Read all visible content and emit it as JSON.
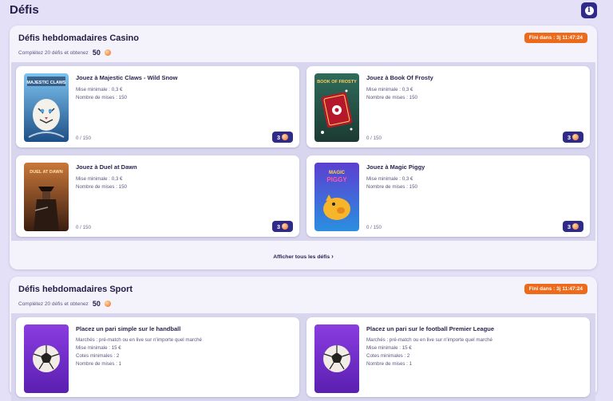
{
  "page": {
    "title": "Défis"
  },
  "casino": {
    "title": "Défis hebdomadaires Casino",
    "subtitle": "Complétez 20 défis et obtenez",
    "reward": "50",
    "timer": "Fini dans : 3j 11:47:24",
    "show_all": "Afficher tous les défis",
    "cards": [
      {
        "title": "Jouez à Majestic Claws - Wild Snow",
        "line1": "Mise minimale : 0,3 €",
        "line2": "Nombre de mises : 150",
        "progress": "0 / 150",
        "reward": "3",
        "thumb": "MAJESTIC CLAWS"
      },
      {
        "title": "Jouez à Book Of Frosty",
        "line1": "Mise minimale : 0,3 €",
        "line2": "Nombre de mises : 150",
        "progress": "0 / 150",
        "reward": "3",
        "thumb": "BOOK OF FROSTY"
      },
      {
        "title": "Jouez à Duel at Dawn",
        "line1": "Mise minimale : 0,3 €",
        "line2": "Nombre de mises : 150",
        "progress": "0 / 150",
        "reward": "3",
        "thumb": "DUEL AT DAWN"
      },
      {
        "title": "Jouez à Magic Piggy",
        "line1": "Mise minimale : 0,3 €",
        "line2": "Nombre de mises : 150",
        "progress": "0 / 150",
        "reward": "3",
        "thumb": "MAGIC PIGGY"
      }
    ]
  },
  "sport": {
    "title": "Défis hebdomadaires Sport",
    "subtitle": "Complétez 20 défis et obtenez",
    "reward": "50",
    "timer": "Fini dans : 3j 11:47:24",
    "cards": [
      {
        "title": "Placez un pari simple sur le handball",
        "line1": "Marchés : pré-match ou en live sur n'importe quel marché",
        "line2": "Mise minimale : 15 €",
        "line3": "Cotes minimales : 2",
        "line4": "Nombre de mises : 1"
      },
      {
        "title": "Placez un pari sur le football Premier League",
        "line1": "Marchés : pré-match ou en live sur n'importe quel marché",
        "line2": "Mise minimale : 15 €",
        "line3": "Cotes minimales : 2",
        "line4": "Nombre de mises : 1"
      }
    ]
  },
  "colors": {
    "accent": "#2f2a8a",
    "timer": "#ec6a19",
    "background": "#e3e0f7"
  },
  "icons": {
    "info": "info-icon",
    "coin": "coin-icon",
    "chevron": "chevron-right-icon"
  }
}
